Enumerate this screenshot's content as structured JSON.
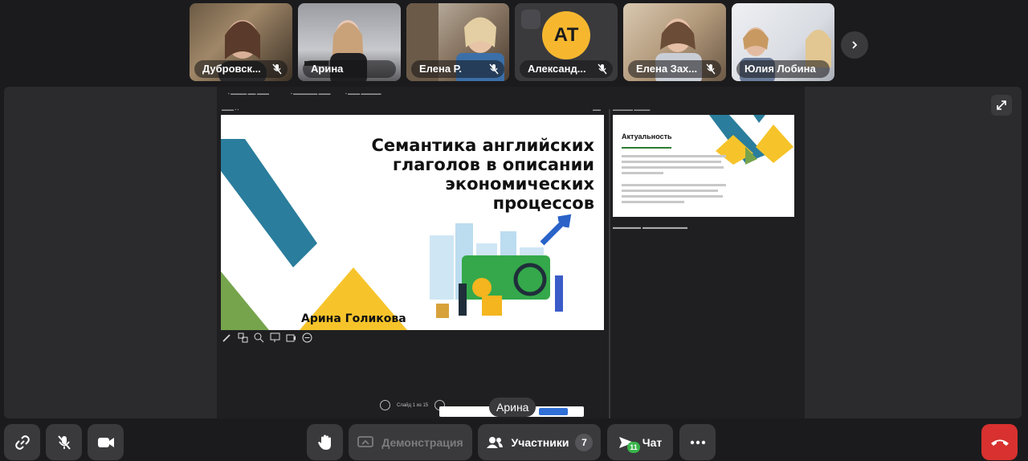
{
  "participants": [
    {
      "name": "Дубровск...",
      "muted": true,
      "type": "video"
    },
    {
      "name": "Арина",
      "muted": false,
      "type": "video"
    },
    {
      "name": "Елена Р.",
      "muted": true,
      "type": "video"
    },
    {
      "name": "Александ...",
      "muted": true,
      "type": "avatar",
      "initials": "АТ",
      "avatar_color": "#f6b72f"
    },
    {
      "name": "Елена Зах...",
      "muted": true,
      "type": "video"
    },
    {
      "name": "Юлия Лобина",
      "muted": false,
      "type": "video"
    }
  ],
  "presentation": {
    "slide_title": "Семантика английских глаголов в описании экономических процессов",
    "slide_author": "Арина Голикова",
    "next_slide_title": "Актуальность",
    "slide_counter": "Слайд 1 из 15"
  },
  "speaker_label": "Арина",
  "toolbar": {
    "demo_label": "Демонстрация",
    "participants_label": "Участники",
    "participants_count": "7",
    "chat_label": "Чат",
    "chat_unread": "11"
  },
  "colors": {
    "background": "#1b1b1d",
    "panel": "#3a3a3d",
    "hangup": "#d8312f",
    "accent_yellow": "#f6b72f",
    "chat_badge": "#39b54a"
  },
  "icons": [
    "link-icon",
    "mic-off-icon",
    "camera-icon",
    "hand-icon",
    "screen-share-icon",
    "participants-icon",
    "chat-icon",
    "more-icon",
    "hangup-icon",
    "chevron-right-icon",
    "fullscreen-icon"
  ]
}
